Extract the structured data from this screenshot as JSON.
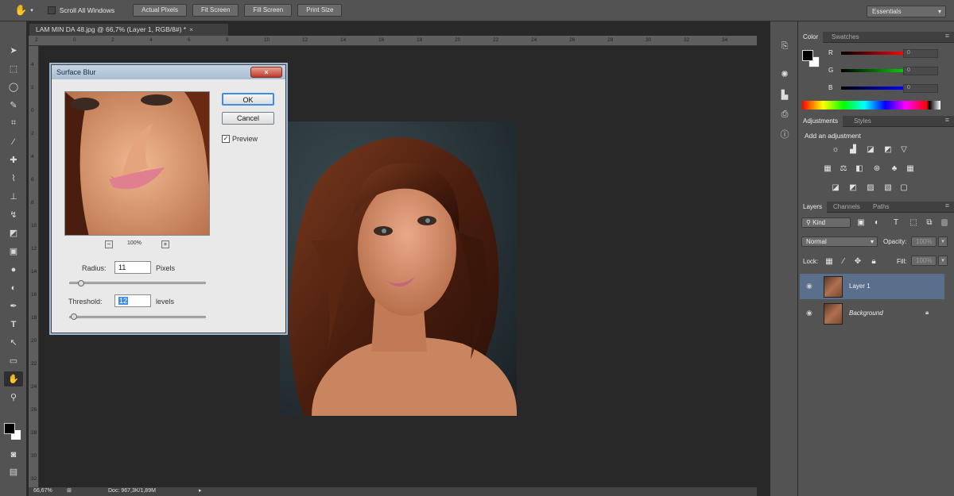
{
  "options_bar": {
    "hand_icon": "hand-icon",
    "scroll_all_label": "Scroll All Windows",
    "buttons": [
      "Actual Pixels",
      "Fit Screen",
      "Fill Screen",
      "Print Size"
    ],
    "workspace": "Essentials"
  },
  "document": {
    "tab_title": "LAM MIN DA 48.jpg @ 66,7% (Layer 1, RGB/8#) *",
    "tab_close": "×",
    "ruler_h": [
      "2",
      "0",
      "2",
      "4",
      "6",
      "8",
      "10",
      "12",
      "14",
      "16",
      "18",
      "20",
      "22",
      "24",
      "26",
      "28",
      "30",
      "32",
      "34"
    ],
    "ruler_v": [
      "4",
      "2",
      "0",
      "2",
      "4",
      "6",
      "8",
      "10",
      "12",
      "14",
      "16",
      "18",
      "20",
      "22",
      "24",
      "26",
      "28",
      "30",
      "32"
    ],
    "zoom": "66,67%",
    "doc_info": "Doc: 967,3K/1,89M"
  },
  "dialog": {
    "title": "Surface Blur",
    "close": "×",
    "ok": "OK",
    "cancel": "Cancel",
    "preview_label": "Preview",
    "preview_checked": true,
    "zoom_minus": "−",
    "zoom_plus": "+",
    "zoom_level": "100%",
    "radius_label": "Radius:",
    "radius_value": "11",
    "radius_unit": "Pixels",
    "threshold_label": "Threshold:",
    "threshold_value": "12",
    "threshold_unit": "levels"
  },
  "color_panel": {
    "tabs": [
      "Color",
      "Swatches"
    ],
    "channels": [
      {
        "label": "R",
        "value": "0",
        "color": "#ff0000"
      },
      {
        "label": "G",
        "value": "0",
        "color": "#00cc00"
      },
      {
        "label": "B",
        "value": "0",
        "color": "#0000ff"
      }
    ]
  },
  "adjustments_panel": {
    "tabs": [
      "Adjustments",
      "Styles"
    ],
    "heading": "Add an adjustment"
  },
  "layers_panel": {
    "tabs": [
      "Layers",
      "Channels",
      "Paths"
    ],
    "kind_filter": "Kind",
    "blend_mode": "Normal",
    "opacity_label": "Opacity:",
    "opacity_value": "100%",
    "lock_label": "Lock:",
    "fill_label": "Fill:",
    "fill_value": "100%",
    "layers": [
      {
        "name": "Layer 1",
        "selected": true
      },
      {
        "name": "Background",
        "selected": false,
        "locked": true
      }
    ]
  },
  "colors": {
    "ui_bg": "#535353",
    "canvas_bg": "#282828",
    "selection": "#5a6f8c",
    "ok_focus": "#3c8ee8"
  }
}
